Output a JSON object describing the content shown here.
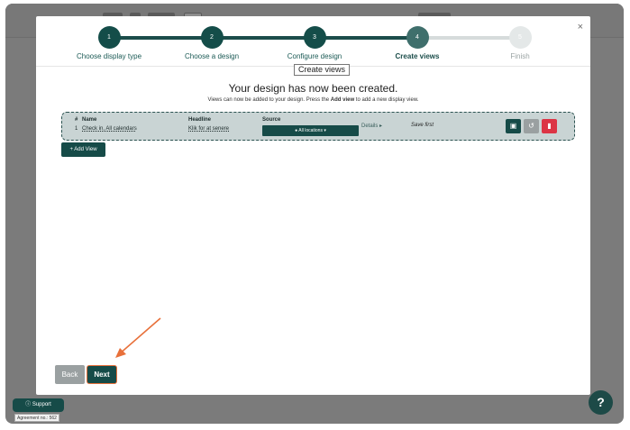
{
  "modal": {
    "close_label": "×"
  },
  "stepper": {
    "steps": [
      {
        "number": "1",
        "label": "Choose display type",
        "state": "done"
      },
      {
        "number": "2",
        "label": "Choose a design",
        "state": "done"
      },
      {
        "number": "3",
        "label": "Configure design",
        "state": "done"
      },
      {
        "number": "4",
        "label": "Create views",
        "state": "active"
      },
      {
        "number": "5",
        "label": "Finish",
        "state": "todo"
      }
    ],
    "tooltip": "Create views"
  },
  "content": {
    "heading": "Your design has now been created.",
    "subtext_before": "Views can now be added to your design. Press the ",
    "subtext_bold": "Add view",
    "subtext_after": " to add a new display view."
  },
  "views_table": {
    "headers": {
      "number": "#",
      "name": "Name",
      "headline": "Headline",
      "source": "Source"
    },
    "rows": [
      {
        "number": "1",
        "name": "Check in, All calendars",
        "headline": "Klik for at senere",
        "source_button": "All locations",
        "details": "Details",
        "status": "Save first"
      }
    ]
  },
  "buttons": {
    "add_view": "Add View",
    "back": "Back",
    "next": "Next",
    "support": "Support",
    "help": "?"
  },
  "footer": {
    "agreement": "Agreement no.: 562"
  },
  "colors": {
    "primary": "#164b48",
    "danger": "#dc3545",
    "secondary": "#9aa0a1",
    "annotation": "#e8703a"
  }
}
